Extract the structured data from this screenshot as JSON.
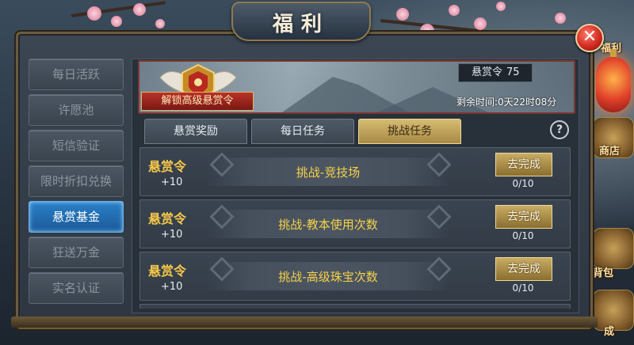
{
  "window": {
    "title": "福利"
  },
  "close": {
    "label": "✕"
  },
  "sidebar": {
    "items": [
      {
        "label": "每日活跃",
        "active": false
      },
      {
        "label": "许愿池",
        "active": false
      },
      {
        "label": "短信验证",
        "active": false
      },
      {
        "label": "限时折扣兑换",
        "active": false
      },
      {
        "label": "悬赏基金",
        "active": true
      },
      {
        "label": "狂送万金",
        "active": false
      },
      {
        "label": "实名认证",
        "active": false
      }
    ]
  },
  "banner": {
    "badge_label": "解锁高级悬赏令",
    "currency_label": "悬赏令",
    "currency_value": "75",
    "timer": "剩余时间:0天22时08分"
  },
  "tabs": [
    {
      "label": "悬赏奖励",
      "active": false
    },
    {
      "label": "每日任务",
      "active": false
    },
    {
      "label": "挑战任务",
      "active": true
    }
  ],
  "help": {
    "label": "?"
  },
  "tasks": [
    {
      "reward_name": "悬赏令",
      "reward_amount": "+10",
      "task": "挑战-竞技场",
      "button": "去完成",
      "progress": "0/10"
    },
    {
      "reward_name": "悬赏令",
      "reward_amount": "+10",
      "task": "挑战-教本使用次数",
      "button": "去完成",
      "progress": "0/10"
    },
    {
      "reward_name": "悬赏令",
      "reward_amount": "+10",
      "task": "挑战-高级珠宝次数",
      "button": "去完成",
      "progress": "0/10"
    }
  ],
  "side_scenery": {
    "labels": [
      "福利",
      "商店",
      "背包",
      "成"
    ]
  },
  "colors": {
    "accent_gold": "#f5c84a",
    "active_blue": "#2a80c8",
    "close_red": "#d32c22"
  }
}
